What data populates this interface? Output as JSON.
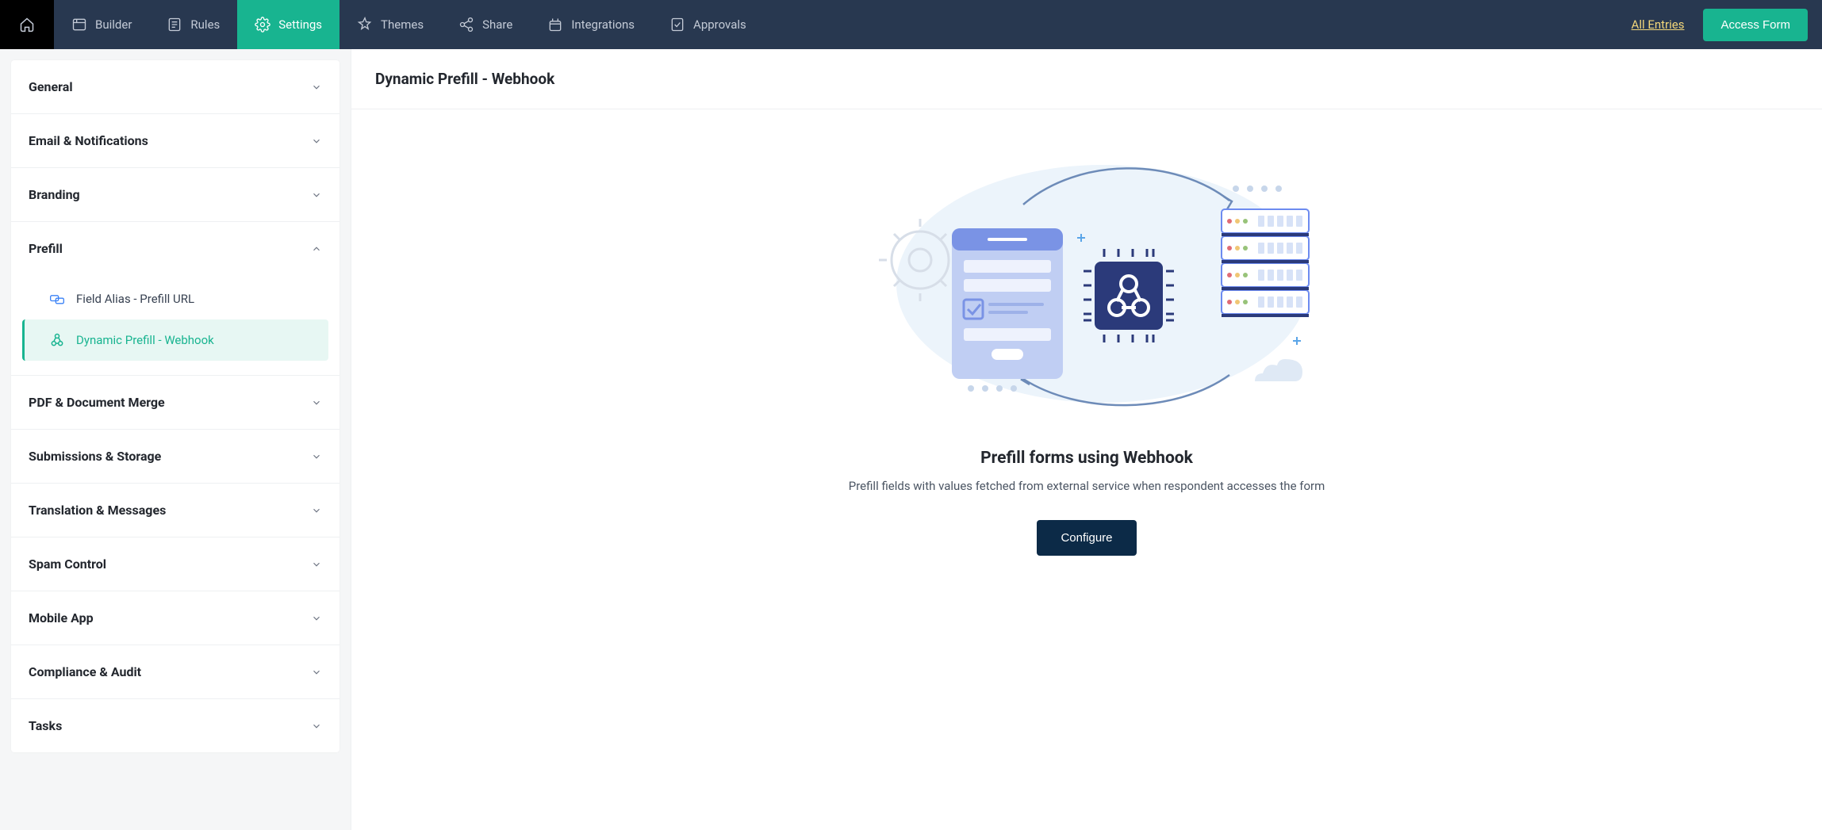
{
  "topnav": {
    "items": [
      {
        "label": "Builder"
      },
      {
        "label": "Rules"
      },
      {
        "label": "Settings"
      },
      {
        "label": "Themes"
      },
      {
        "label": "Share"
      },
      {
        "label": "Integrations"
      },
      {
        "label": "Approvals"
      }
    ],
    "all_entries": "All Entries",
    "access_form": "Access Form"
  },
  "sidebar": {
    "sections": [
      {
        "title": "General"
      },
      {
        "title": "Email & Notifications"
      },
      {
        "title": "Branding"
      },
      {
        "title": "Prefill"
      },
      {
        "title": "PDF & Document Merge"
      },
      {
        "title": "Submissions & Storage"
      },
      {
        "title": "Translation & Messages"
      },
      {
        "title": "Spam Control"
      },
      {
        "title": "Mobile App"
      },
      {
        "title": "Compliance & Audit"
      },
      {
        "title": "Tasks"
      }
    ],
    "prefill_subitems": [
      {
        "label": "Field Alias - Prefill URL"
      },
      {
        "label": "Dynamic Prefill - Webhook"
      }
    ]
  },
  "page": {
    "title": "Dynamic Prefill - Webhook",
    "hero_title": "Prefill forms using Webhook",
    "hero_subtitle": "Prefill fields with values fetched from external service when respondent accesses the form",
    "configure": "Configure"
  },
  "colors": {
    "accent": "#18b490",
    "navbg": "#283850",
    "highlight": "#f3d77a",
    "darkbtn": "#0c2a47"
  }
}
